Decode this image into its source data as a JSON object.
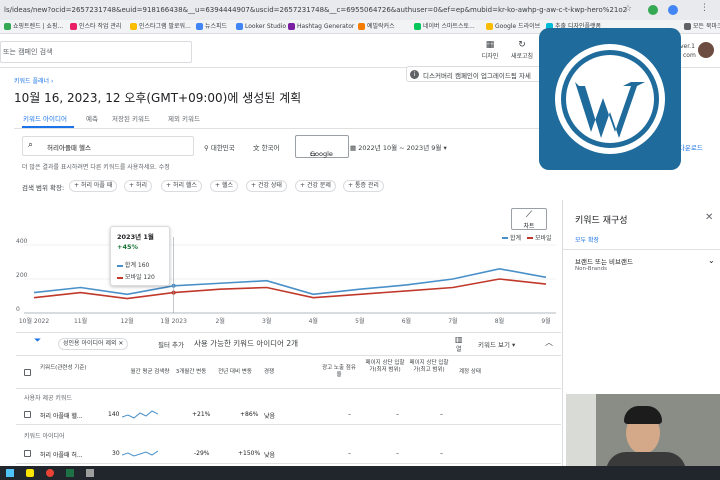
{
  "browser": {
    "url": "ls/ideas/new?ocid=2657231748&euid=918166438&__u=6394444907&uscid=2657231748&__c=6955064726&authuser=0&ef=ep&mubid=kr-ko-awhp-g-aw-c-t-kwp-hero%21o2"
  },
  "bookmarks": [
    {
      "label": "쇼핑트렌드 | 쇼핑...",
      "color": "#34a853"
    },
    {
      "label": "인스타 작업 관리",
      "color": "#e91e63"
    },
    {
      "label": "인스타그램 팔로워...",
      "color": "#fbbc04"
    },
    {
      "label": "뉴스피드",
      "color": "#4285f4"
    },
    {
      "label": "Looker Studio",
      "color": "#4285f4"
    },
    {
      "label": "Hashtag Generator",
      "color": "#7b1fa2"
    },
    {
      "label": "예빌락커스",
      "color": "#f57c00"
    },
    {
      "label": "네이버 스마트스토...",
      "color": "#03c75a"
    },
    {
      "label": "Google 드라이브",
      "color": "#fbbc04"
    },
    {
      "label": "추출 디자인플랫폼",
      "color": "#00bcd4"
    },
    {
      "label": "모든 북마크",
      "color": "#5f6368"
    }
  ],
  "topbar": {
    "search_placeholder": "또는 캠페인 검색",
    "tools": [
      {
        "icon": "design-icon",
        "label": "디자인"
      },
      {
        "icon": "refresh-icon",
        "label": "새로고침"
      }
    ],
    "account_label": "ver.1",
    "account_sub": "com"
  },
  "header": {
    "breadcrumb": "키워드 플래너",
    "title": "10월 16, 2023, 12 오후(GMT+09:00)에 생성된 계획",
    "tabs": [
      "키워드 아이디어",
      "예측",
      "저장된 키워드",
      "제외 키워드"
    ],
    "active_tab": 0
  },
  "notice": {
    "text": "디스커버리 캠페인이 업그레이드됨  자세"
  },
  "filters": {
    "keyword": "허리아플때 헬스",
    "location": "대한민국",
    "language": "한국어",
    "network": "Google",
    "date_range": "2022년 10월 ~ 2023년 9월",
    "download": "다운로드",
    "hint": "더 많은 결과를 표시하려면 다른 키워드를 사용하세요. 수정",
    "widen_label": "검색 범위 확장:",
    "chips": [
      "허리 아플 때",
      "허리",
      "허리 헬스",
      "헬스",
      "건강 상태",
      "건강 문제",
      "통증 관리"
    ]
  },
  "chart_panel": {
    "button_label": "차트",
    "legend": [
      {
        "name": "합계",
        "color": "#4a90c8"
      },
      {
        "name": "모바일",
        "color": "#c0392b"
      }
    ],
    "tooltip": {
      "date": "2023년 1월",
      "change": "+45%",
      "total_label": "합계",
      "total_value": "160",
      "mobile_label": "모바일",
      "mobile_value": "120"
    }
  },
  "chart_data": {
    "type": "line",
    "x": [
      "10월 2022",
      "11월",
      "12월",
      "1월 2023",
      "2월",
      "3월",
      "4월",
      "5월",
      "6월",
      "7월",
      "8월",
      "9월"
    ],
    "xticks": [
      "10월 2022",
      "11월",
      "12월",
      "1월 2023",
      "2월",
      "3월",
      "4월",
      "5월",
      "6월",
      "7월",
      "8월",
      "9월"
    ],
    "yticks": [
      "0",
      "200",
      "400"
    ],
    "ylim": [
      0,
      400
    ],
    "series": [
      {
        "name": "합계",
        "color": "#4a90c8",
        "values": [
          120,
          150,
          110,
          160,
          175,
          190,
          110,
          140,
          165,
          200,
          260,
          210
        ]
      },
      {
        "name": "모바일",
        "color": "#c0392b",
        "values": [
          90,
          120,
          85,
          120,
          140,
          150,
          90,
          110,
          130,
          150,
          200,
          170
        ]
      }
    ],
    "legend_position": "top-right",
    "grid": true
  },
  "table_toolbar": {
    "filter_chip": "성인용 아이디어 제외",
    "add_filter": "필터 추가",
    "available": "사용 가능한 키워드 아이디어 2개",
    "column_label": "열",
    "view_label": "키워드 보기"
  },
  "table": {
    "columns": [
      "키워드(관련성 기준)",
      "월간 평균 검색량",
      "3개월간 변동",
      "전년 대비 변동",
      "경쟁",
      "광고 노출 점유율",
      "페이지 상단 입찰가(최저 범위)",
      "페이지 상단 입찰가(최고 범위)",
      "계정 상태"
    ],
    "groups": [
      {
        "label": "사용자 제공 키워드",
        "rows": [
          {
            "keyword": "허리 아플때 헬...",
            "volume": "140",
            "three_month": "+21%",
            "yoy": "+86%",
            "competition": "낮음",
            "share": "–",
            "bid_low": "–",
            "bid_high": "–"
          }
        ]
      },
      {
        "label": "키워드 아이디어",
        "rows": [
          {
            "keyword": "허리 아플때 허...",
            "volume": "30",
            "three_month": "-29%",
            "yoy": "+150%",
            "competition": "낮음",
            "share": "–",
            "bid_low": "–",
            "bid_high": "–"
          }
        ]
      }
    ]
  },
  "right_panel": {
    "title": "키워드 재구성",
    "expand_all": "모두 확장",
    "section_title": "브랜드 또는 비브랜드",
    "section_sub": "Non-Brands"
  }
}
